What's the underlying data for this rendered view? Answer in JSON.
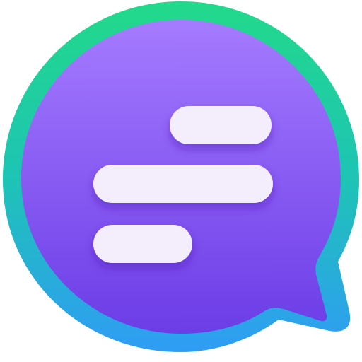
{
  "icon": {
    "name": "chat-bubble-app-icon",
    "colors": {
      "ring_top": "#22d98a",
      "ring_mid": "#1ec4b4",
      "ring_bottom": "#2f9cf5",
      "bubble_top": "#a57bff",
      "bubble_bottom": "#6c3ce6",
      "bar_fill": "#f4eefc",
      "bar_shadow": "#4a1fb0"
    }
  }
}
